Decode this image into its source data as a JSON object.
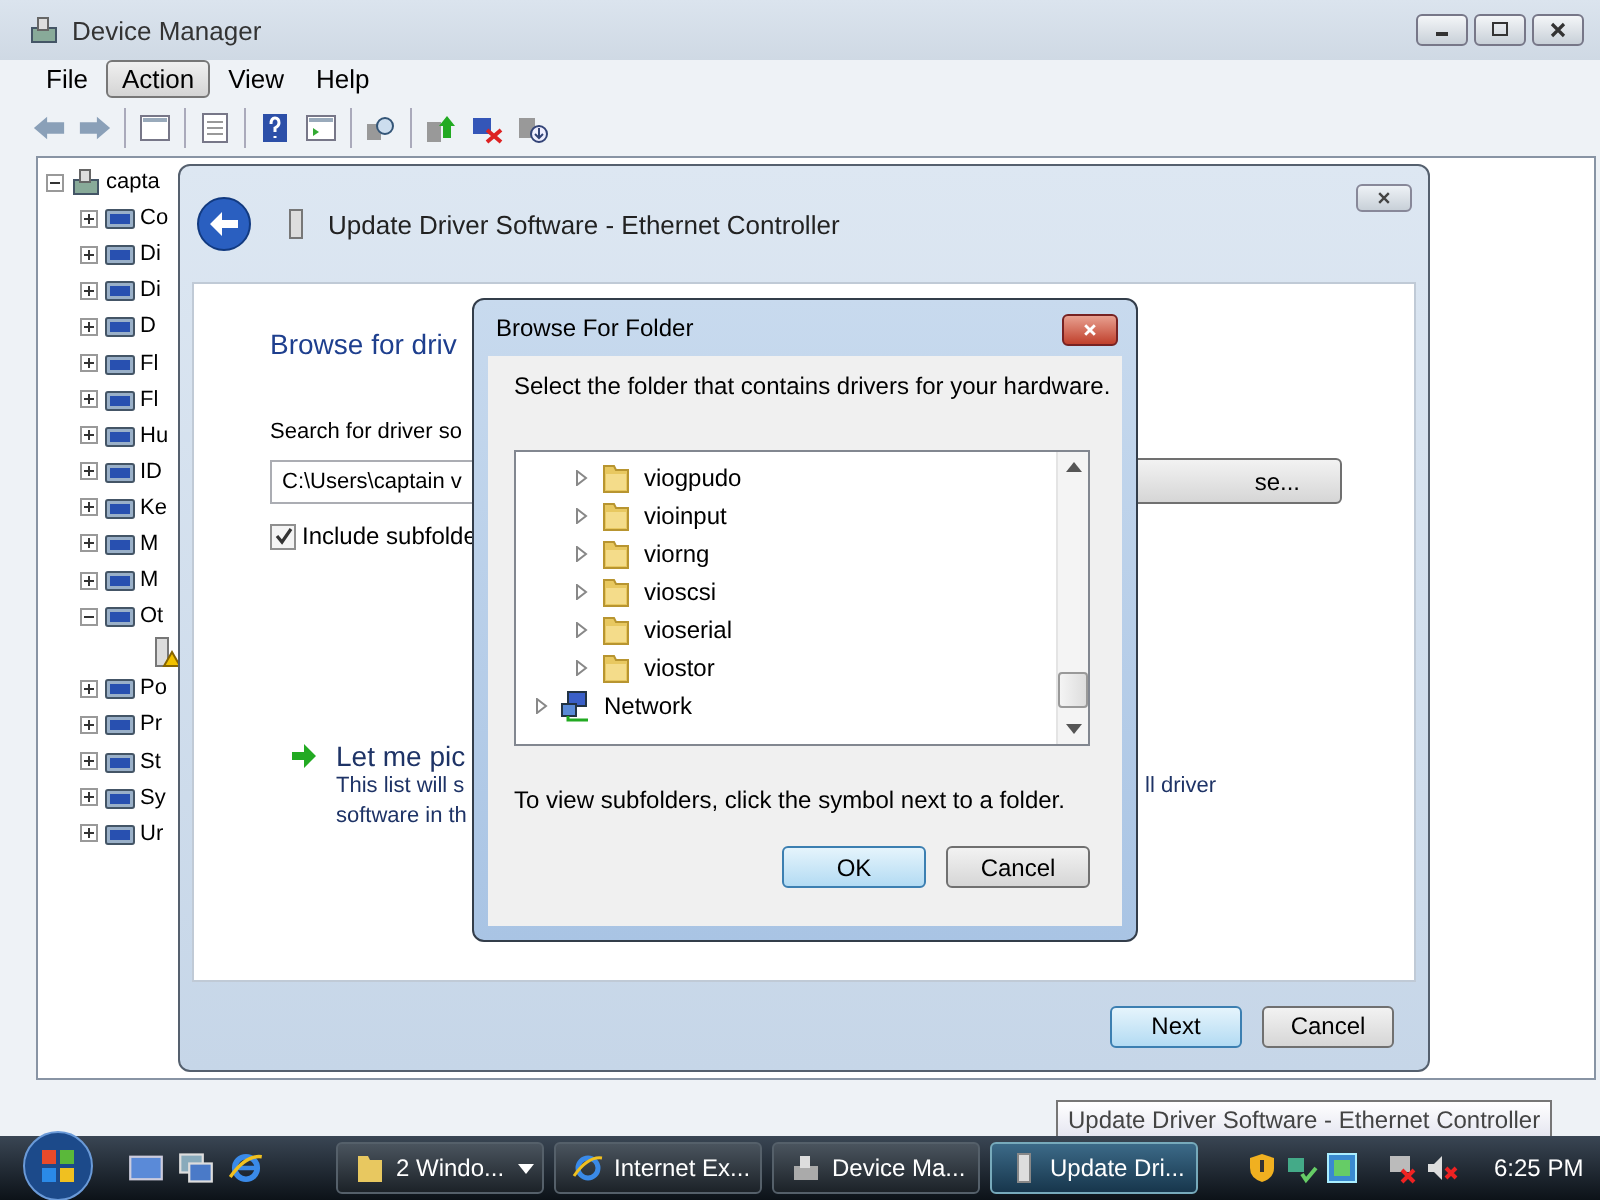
{
  "device_manager": {
    "title": "Device Manager",
    "menu": [
      {
        "label": "File",
        "selected": false
      },
      {
        "label": "Action",
        "selected": true
      },
      {
        "label": "View",
        "selected": false
      },
      {
        "label": "Help",
        "selected": false
      }
    ],
    "tree": {
      "label": "capta",
      "expanded": true,
      "children": [
        {
          "label": "Co",
          "expanded": false
        },
        {
          "label": "Di",
          "expanded": false
        },
        {
          "label": "Di",
          "expanded": false
        },
        {
          "label": "D",
          "expanded": false
        },
        {
          "label": "Fl",
          "expanded": false
        },
        {
          "label": "Fl",
          "expanded": false
        },
        {
          "label": "Hu",
          "expanded": false
        },
        {
          "label": "ID",
          "expanded": false
        },
        {
          "label": "Ke",
          "expanded": false
        },
        {
          "label": "M",
          "expanded": false
        },
        {
          "label": "M",
          "expanded": false
        },
        {
          "label": "Ot",
          "expanded": true,
          "children": [
            {
              "warning": true
            }
          ]
        },
        {
          "label": "Po",
          "expanded": false
        },
        {
          "label": "Pr",
          "expanded": false
        },
        {
          "label": "St",
          "expanded": false
        },
        {
          "label": "Sy",
          "expanded": false
        },
        {
          "label": "Ur",
          "expanded": false
        }
      ]
    }
  },
  "update_dialog": {
    "title": "Update Driver Software - Ethernet Controller",
    "heading": "Browse for driv",
    "search_label": "Search for driver so",
    "path_value": "C:\\Users\\captain v",
    "browse_button": "se...",
    "include_subfolders": {
      "label": "Include subfolde",
      "checked": true
    },
    "pick_link": "Let me pic",
    "description_lines": [
      "This list will s",
      "software in th"
    ],
    "description_right": "ll driver",
    "buttons": [
      "Next",
      "Cancel"
    ]
  },
  "browse_folder": {
    "title": "Browse For Folder",
    "instruction": "Select the folder that contains drivers for your hardware.",
    "items": [
      {
        "kind": "folder",
        "label": "viogpudo"
      },
      {
        "kind": "folder",
        "label": "vioinput"
      },
      {
        "kind": "folder",
        "label": "viorng"
      },
      {
        "kind": "folder",
        "label": "vioscsi"
      },
      {
        "kind": "folder",
        "label": "vioserial"
      },
      {
        "kind": "folder",
        "label": "viostor"
      },
      {
        "kind": "network",
        "label": "Network"
      }
    ],
    "hint": "To view subfolders, click the symbol next to a folder.",
    "buttons": [
      "OK",
      "Cancel"
    ]
  },
  "tooltip": "Update Driver Software - Ethernet Controller",
  "taskbar": {
    "tasks": [
      {
        "label": "2 Windo...",
        "kind": "folder",
        "selected": false
      },
      {
        "label": "Internet Ex...",
        "kind": "browser",
        "selected": false
      },
      {
        "label": "Device Ma...",
        "kind": "device",
        "selected": false
      },
      {
        "label": "Update Dri...",
        "kind": "driver",
        "selected": true
      }
    ],
    "clock": "6:25 PM"
  }
}
